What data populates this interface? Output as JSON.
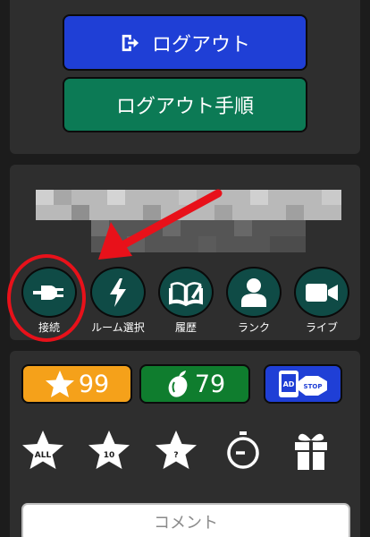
{
  "top_panel": {
    "logout_label": "ログアウト",
    "logout_steps_label": "ログアウト手順"
  },
  "menu": {
    "items": [
      {
        "label": "接続",
        "icon": "plug-icon"
      },
      {
        "label": "ルーム選択",
        "icon": "lightning-icon"
      },
      {
        "label": "履歴",
        "icon": "book-icon"
      },
      {
        "label": "ランク",
        "icon": "person-icon"
      },
      {
        "label": "ライブ",
        "icon": "video-camera-icon"
      }
    ]
  },
  "stats": {
    "stars": "99",
    "seeds": "79",
    "adstop_ad": "AD",
    "adstop_stop": "STOP"
  },
  "filters": [
    {
      "label": "ALL",
      "icon": "star-icon"
    },
    {
      "label": "10",
      "icon": "star-icon"
    },
    {
      "label": "?",
      "icon": "star-icon"
    },
    {
      "label": "",
      "icon": "stopwatch-icon"
    },
    {
      "label": "",
      "icon": "gift-icon"
    }
  ],
  "comment": {
    "placeholder": "コメント"
  },
  "colors": {
    "logout_blue": "#1f3fd6",
    "steps_green": "#0c7a55",
    "star_orange": "#f5a11a",
    "seed_green": "#0f7d2e",
    "highlight_red": "#e8111a",
    "circle_teal": "#0f4b46"
  }
}
